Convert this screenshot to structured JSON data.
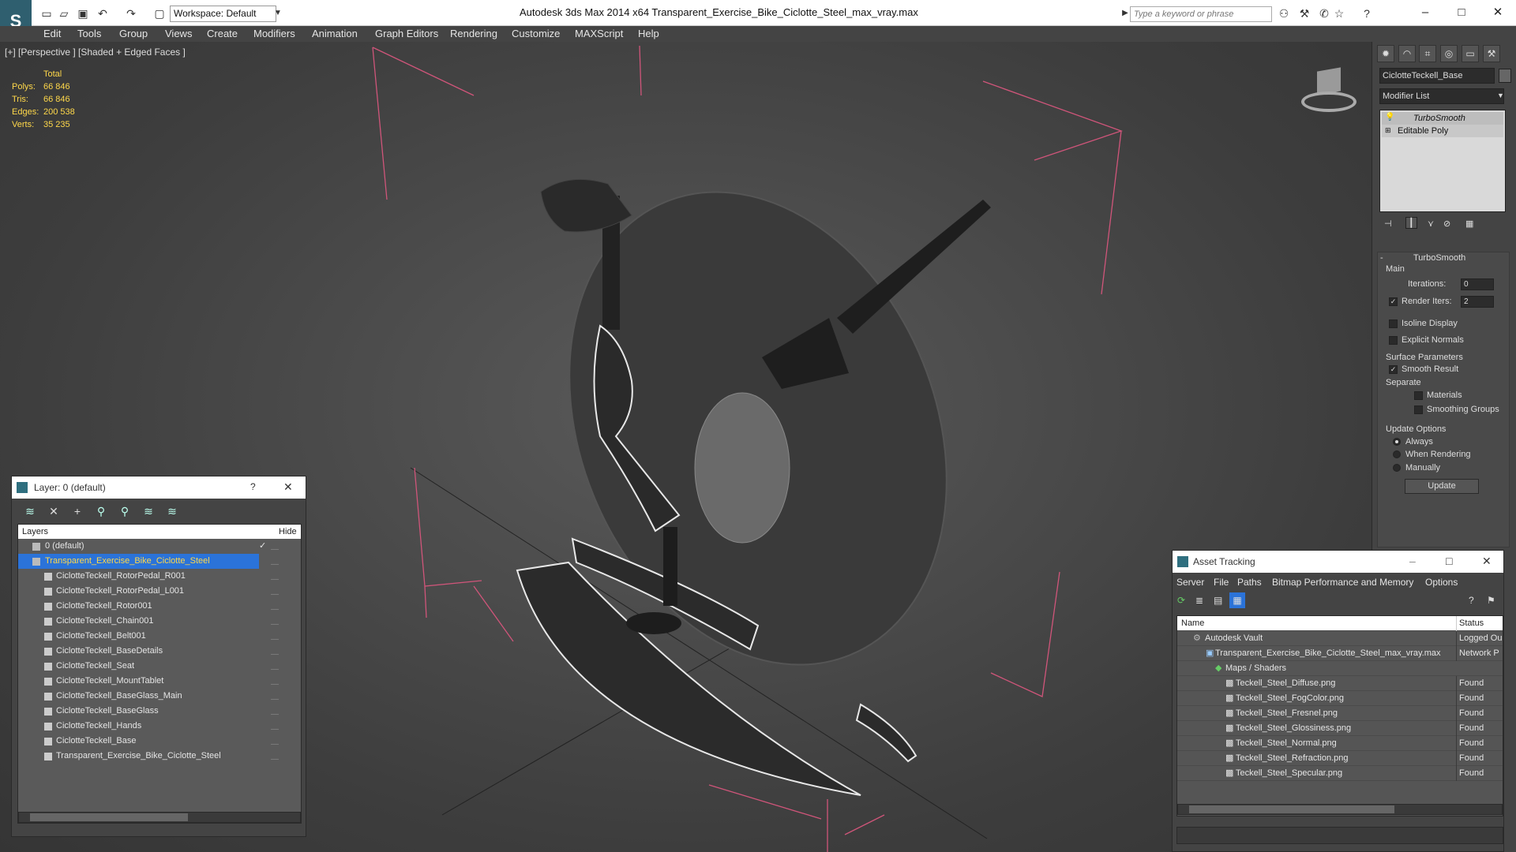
{
  "titlebar": {
    "app_title": "Autodesk 3ds Max  2014 x64     Transparent_Exercise_Bike_Ciclotte_Steel_max_vray.max",
    "workspace": "Workspace: Default",
    "search_placeholder": "Type a keyword or phrase"
  },
  "menu": [
    "Edit",
    "Tools",
    "Group",
    "Views",
    "Create",
    "Modifiers",
    "Animation",
    "Graph Editors",
    "Rendering",
    "Customize",
    "MAXScript",
    "Help"
  ],
  "viewport": {
    "label": "[+] [Perspective ] [Shaded + Edged Faces ]",
    "stats_header": "Total",
    "stats": [
      {
        "label": "Polys:",
        "value": "66 846"
      },
      {
        "label": "Tris:",
        "value": "66 846"
      },
      {
        "label": "Edges:",
        "value": "200 538"
      },
      {
        "label": "Verts:",
        "value": "35 235"
      }
    ]
  },
  "command_panel": {
    "object_name": "CiclotteTeckell_Base",
    "modifier_list": "Modifier List",
    "stack": [
      "TurboSmooth",
      "Editable Poly"
    ],
    "turbosmooth": {
      "title": "TurboSmooth",
      "main": "Main",
      "iterations_label": "Iterations:",
      "iterations_value": "0",
      "render_iters_label": "Render Iters:",
      "render_iters_value": "2",
      "isoline": "Isoline Display",
      "explicit": "Explicit Normals",
      "surface": "Surface Parameters",
      "smooth_result": "Smooth Result",
      "separate": "Separate",
      "materials": "Materials",
      "smoothing_groups": "Smoothing Groups",
      "update_options": "Update Options",
      "always": "Always",
      "when_rendering": "When Rendering",
      "manually": "Manually",
      "update_button": "Update"
    }
  },
  "layer_window": {
    "title": "Layer: 0 (default)",
    "help": "?",
    "col_layers": "Layers",
    "col_hide": "Hide",
    "rows": [
      "0 (default)",
      "Transparent_Exercise_Bike_Ciclotte_Steel",
      "CiclotteTeckell_RotorPedal_R001",
      "CiclotteTeckell_RotorPedal_L001",
      "CiclotteTeckell_Rotor001",
      "CiclotteTeckell_Chain001",
      "CiclotteTeckell_Belt001",
      "CiclotteTeckell_BaseDetails",
      "CiclotteTeckell_Seat",
      "CiclotteTeckell_MountTablet",
      "CiclotteTeckell_BaseGlass_Main",
      "CiclotteTeckell_BaseGlass",
      "CiclotteTeckell_Hands",
      "CiclotteTeckell_Base",
      "Transparent_Exercise_Bike_Ciclotte_Steel"
    ]
  },
  "asset_window": {
    "title": "Asset Tracking",
    "menu": [
      "Server",
      "File",
      "Paths",
      "Bitmap Performance and Memory",
      "Options"
    ],
    "col_name": "Name",
    "col_status": "Status",
    "rows": [
      {
        "name": "Autodesk Vault",
        "status": "Logged Ou"
      },
      {
        "name": "Transparent_Exercise_Bike_Ciclotte_Steel_max_vray.max",
        "status": "Network P"
      },
      {
        "name": "Maps / Shaders",
        "status": ""
      },
      {
        "name": "Teckell_Steel_Diffuse.png",
        "status": "Found"
      },
      {
        "name": "Teckell_Steel_FogColor.png",
        "status": "Found"
      },
      {
        "name": "Teckell_Steel_Fresnel.png",
        "status": "Found"
      },
      {
        "name": "Teckell_Steel_Glossiness.png",
        "status": "Found"
      },
      {
        "name": "Teckell_Steel_Normal.png",
        "status": "Found"
      },
      {
        "name": "Teckell_Steel_Refraction.png",
        "status": "Found"
      },
      {
        "name": "Teckell_Steel_Specular.png",
        "status": "Found"
      }
    ]
  }
}
